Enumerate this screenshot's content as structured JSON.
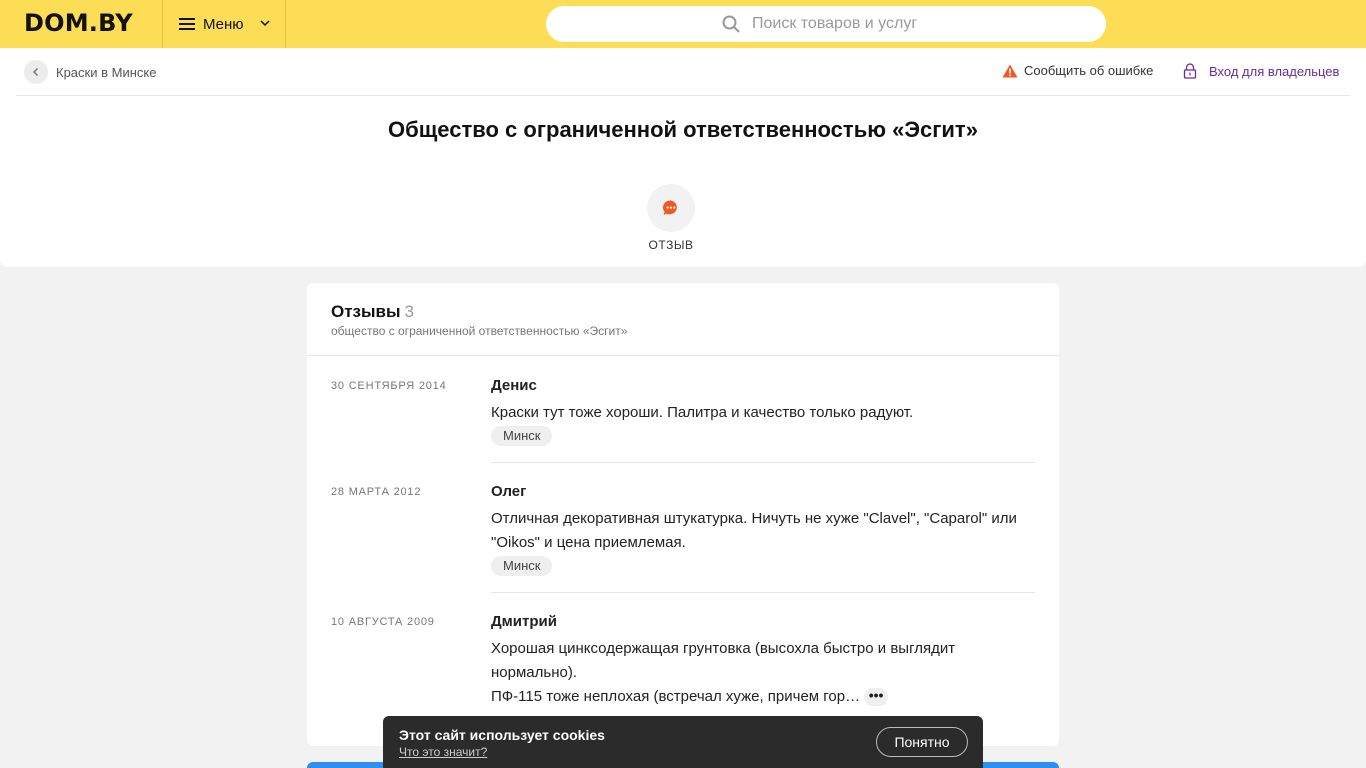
{
  "header": {
    "logo": "DOM.BY",
    "menu_label": "Меню",
    "search_placeholder": "Поиск товаров и услуг"
  },
  "nav": {
    "breadcrumb": "Краски в Минске",
    "report_error": "Сообщить об ошибке",
    "owner_login": "Вход для владельцев"
  },
  "company": {
    "title": "Общество с ограниченной ответственностью «Эсгит»",
    "review_action_label": "ОТЗЫВ"
  },
  "reviews": {
    "heading": "Отзывы",
    "count": "3",
    "subtitle": "общество с ограниченной ответственностью «Эсгит»",
    "items": [
      {
        "date": "30 сентября 2014",
        "author": "Денис",
        "text": "Краски тут тоже хороши. Палитра и качество только радуют.",
        "city": "Минск"
      },
      {
        "date": "28 марта 2012",
        "author": "Олег",
        "text": "Отличная декоративная штукатурка. Ничуть не хуже \"Clavel\", \"Caparol\" или \"Oikos\" и цена приемлемая.",
        "city": "Минск"
      },
      {
        "date": "10 августа 2009",
        "author": "Дмитрий",
        "text": "Хорошая цинксодержащая грунтовка (высохла быстро и выглядит нормально).",
        "text2": "ПФ-115 тоже неплохая (встречал хуже, причем гор…",
        "more": "•••"
      }
    ]
  },
  "cookie": {
    "title": "Этот сайт использует cookies",
    "link": "Что это значит?",
    "button": "Понятно"
  },
  "colors": {
    "brand_yellow": "#fedd56",
    "accent_orange": "#ef5a24",
    "owner_purple": "#6a2c91"
  }
}
